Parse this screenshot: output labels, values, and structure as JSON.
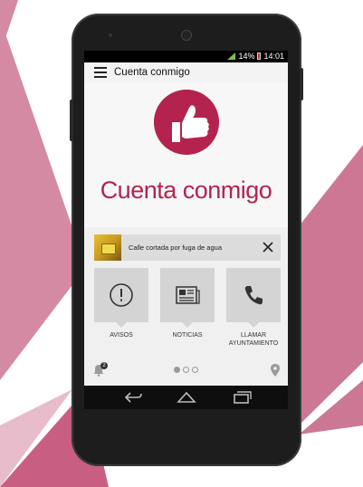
{
  "background": {
    "accent": "#c8728f",
    "light_accent": "#d99bb0"
  },
  "status_bar": {
    "battery_percent": "14%",
    "time": "14:01"
  },
  "app_bar": {
    "title": "Cuenta conmigo",
    "menu_icon": "hamburger-menu-icon"
  },
  "hero": {
    "title": "Cuenta conmigo",
    "icon": "thumbs-up-icon",
    "brand_color": "#b4234e"
  },
  "notification": {
    "text": "Calle cortada por fuga de agua",
    "image": "roadblock-thumbnail",
    "close_icon": "close-icon"
  },
  "tiles": [
    {
      "label": "AVISOS",
      "icon": "alert-circle-icon"
    },
    {
      "label": "NOTICIAS",
      "icon": "newspaper-icon"
    },
    {
      "label": "LLAMAR AYUNTAMIENTO",
      "icon": "phone-icon"
    }
  ],
  "bottom_bar": {
    "badge_count": "2",
    "left_icon": "bell-icon",
    "right_icon": "location-pin-icon",
    "page_count": 3,
    "active_page": 1
  },
  "nav": {
    "back": "back-icon",
    "home": "home-icon",
    "recents": "recents-icon"
  }
}
